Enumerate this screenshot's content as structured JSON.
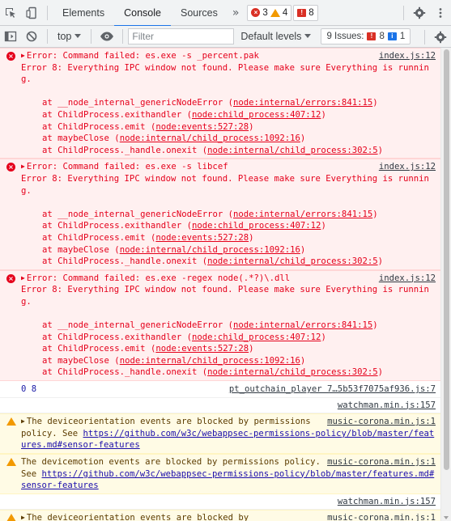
{
  "tabbar": {
    "tabs": [
      {
        "label": "Elements"
      },
      {
        "label": "Console"
      },
      {
        "label": "Sources"
      }
    ],
    "more": "»",
    "error_count": "3",
    "warning_count": "4",
    "issue_count": "8"
  },
  "toolbar": {
    "context": "top",
    "filter_placeholder": "Filter",
    "levels_label": "Default levels",
    "issues_label": "9 Issues:",
    "issues_error_count": "8",
    "issues_info_count": "1"
  },
  "console": {
    "errors": [
      {
        "header": "Error: Command failed: es.exe -s _percent.pak",
        "source": "index.js:12",
        "message": "Error 8: Everything IPC window not found. Please make sure Everything is running.",
        "stack": [
          {
            "fn": "at __node_internal_genericNodeError",
            "loc": "node:internal/errors:841:15"
          },
          {
            "fn": "at ChildProcess.exithandler",
            "loc": "node:child_process:407:12"
          },
          {
            "fn": "at ChildProcess.emit",
            "loc": "node:events:527:28"
          },
          {
            "fn": "at maybeClose",
            "loc": "node:internal/child_process:1092:16"
          },
          {
            "fn": "at ChildProcess._handle.onexit",
            "loc": "node:internal/child_process:302:5"
          }
        ]
      },
      {
        "header": "Error: Command failed: es.exe -s libcef",
        "source": "index.js:12",
        "message": "Error 8: Everything IPC window not found. Please make sure Everything is running.",
        "stack": [
          {
            "fn": "at __node_internal_genericNodeError",
            "loc": "node:internal/errors:841:15"
          },
          {
            "fn": "at ChildProcess.exithandler",
            "loc": "node:child_process:407:12"
          },
          {
            "fn": "at ChildProcess.emit",
            "loc": "node:events:527:28"
          },
          {
            "fn": "at maybeClose",
            "loc": "node:internal/child_process:1092:16"
          },
          {
            "fn": "at ChildProcess._handle.onexit",
            "loc": "node:internal/child_process:302:5"
          }
        ]
      },
      {
        "header": "Error: Command failed: es.exe -regex node(.*?)\\.dll",
        "source": "index.js:12",
        "message": "Error 8: Everything IPC window not found. Please make sure Everything is running.",
        "stack": [
          {
            "fn": "at __node_internal_genericNodeError",
            "loc": "node:internal/errors:841:15"
          },
          {
            "fn": "at ChildProcess.exithandler",
            "loc": "node:child_process:407:12"
          },
          {
            "fn": "at ChildProcess.emit",
            "loc": "node:events:527:28"
          },
          {
            "fn": "at maybeClose",
            "loc": "node:internal/child_process:1092:16"
          },
          {
            "fn": "at ChildProcess._handle.onexit",
            "loc": "node:internal/child_process:302:5"
          }
        ]
      }
    ],
    "log": {
      "text_a": "0",
      "text_b": "8",
      "source": "pt_outchain_player 7…5b53f7075af936.js:7"
    },
    "watch_source_1": "watchman.min.js:157",
    "warn1": {
      "text_before": "The deviceorientation events are blocked by permissions policy. See ",
      "link": "https://github.com/w3c/webappsec-permissions-policy/blob/master/features.md#sensor-features",
      "source": "music-corona.min.js:1"
    },
    "warn2": {
      "text_before": "The devicemotion events are blocked by permissions policy. See ",
      "link": "https://github.com/w3c/webappsec-permissions-policy/blob/master/features.md#sensor-features",
      "source": "music-corona.min.js:1"
    },
    "watch_source_2": "watchman.min.js:157",
    "warn3": {
      "text_before": "The deviceorientation events are blocked by",
      "source": "music-corona.min.js:1"
    }
  },
  "colors": {
    "error_bg": "#fff0f0",
    "error_text": "#e5001b",
    "warning_bg": "#fffbe5",
    "accent": "#1a73e8"
  }
}
